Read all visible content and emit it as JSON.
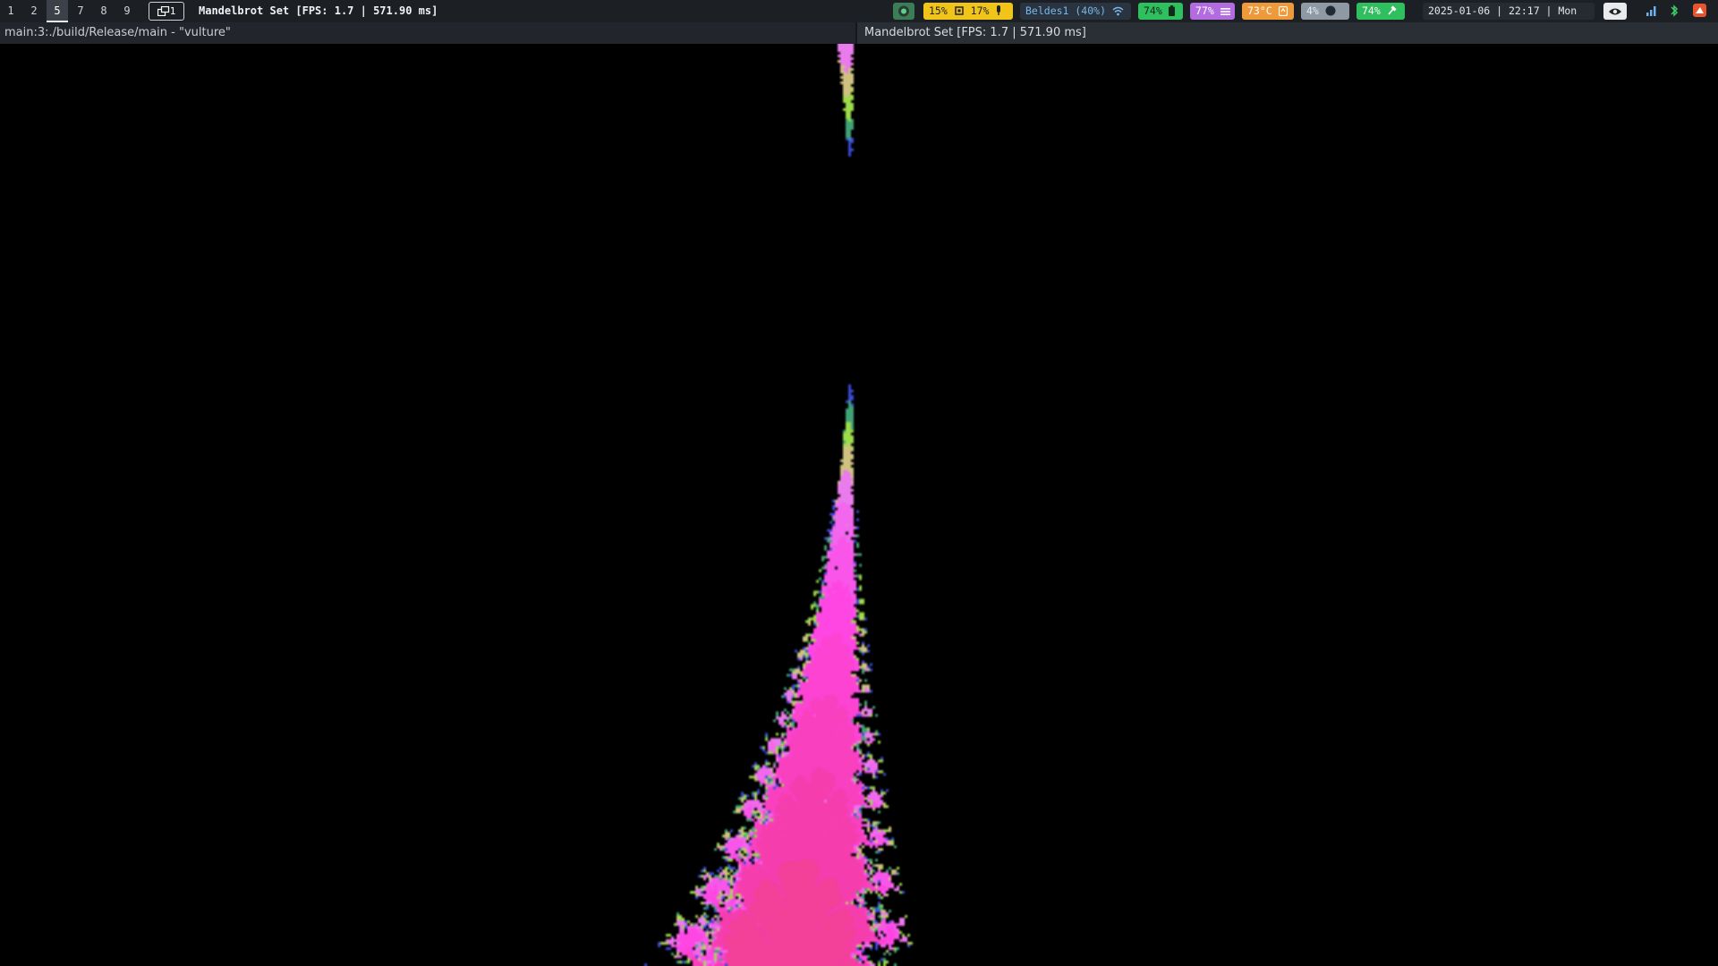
{
  "topbar": {
    "workspaces": [
      "1",
      "2",
      "5",
      "7",
      "8",
      "9"
    ],
    "active_workspace": "5",
    "layout_indicator": "1",
    "window_title": "Mandelbrot Set [FPS: 1.7 | 571.90 ms]",
    "status": {
      "record": {
        "icon": "record-icon",
        "color": "#3fbf6c"
      },
      "cpu": {
        "text": "15% ",
        "icon": "cpu-icon"
      },
      "mic": {
        "text": "17% ",
        "icon": "microphone-icon"
      },
      "network": {
        "text": "Beldes1 (40%) ",
        "icon": "wifi-icon",
        "color": "#7ab7e8"
      },
      "battery": {
        "text": "74% ",
        "icon": "battery-icon",
        "color": "#2fbf5f"
      },
      "memory": {
        "text": "77% ",
        "icon": "memory-icon",
        "color": "#b36ce0"
      },
      "temperature": {
        "text": "73°C ",
        "icon": "thermometer-icon",
        "color": "#ef9a3a"
      },
      "brightness": {
        "text": "4% ",
        "icon": "brightness-icon",
        "color": "#9aa5b1"
      },
      "power": {
        "text": "74% ",
        "icon": "plug-icon",
        "color": "#2fbf5f"
      },
      "datetime": "2025-01-06 | 22:17 | Mon"
    },
    "tray": [
      "eye-icon",
      "signal-icon",
      "bluetooth-icon",
      "app-icon"
    ]
  },
  "tabline": {
    "left_title": "main:3:./build/Release/main - \"vulture\"",
    "right_title": "Mandelbrot Set [FPS: 1.7 | 571.90 ms]"
  },
  "colors": {
    "bar_bg": "#1c1f24",
    "set_color": "#000000"
  }
}
